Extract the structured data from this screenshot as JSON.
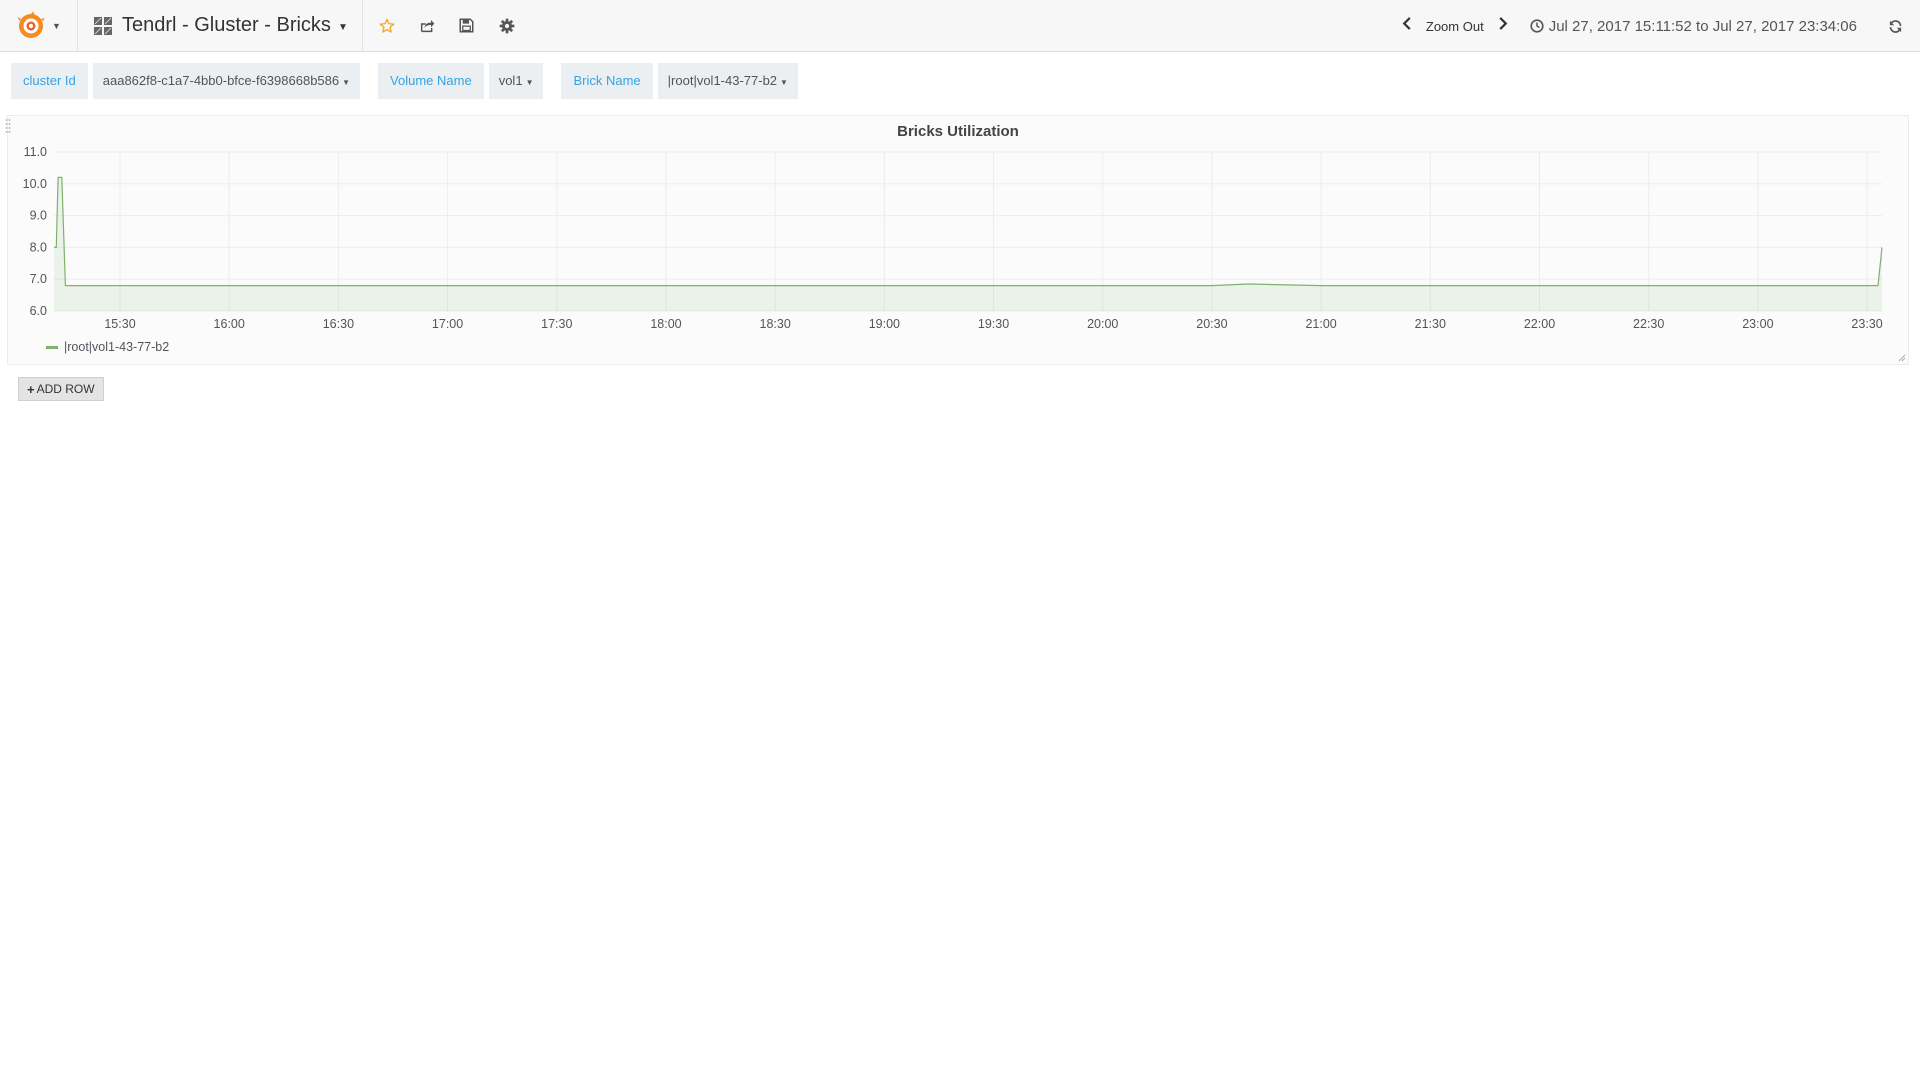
{
  "navbar": {
    "dashboard_title": "Tendrl - Gluster - Bricks",
    "zoom_out_label": "Zoom Out",
    "time_range": "Jul 27, 2017 15:11:52 to Jul 27, 2017 23:34:06",
    "icons": [
      "grafana-logo-icon",
      "dashboard-grid-icon",
      "star-icon",
      "share-icon",
      "save-icon",
      "gear-icon",
      "chevron-left-icon",
      "chevron-right-icon",
      "clock-icon",
      "refresh-icon"
    ],
    "star_color": "#f5a623"
  },
  "variables": [
    {
      "label": "cluster Id",
      "value": "aaa862f8-c1a7-4bb0-bfce-f6398668b586"
    },
    {
      "label": "Volume Name",
      "value": "vol1"
    },
    {
      "label": "Brick Name",
      "value": "|root|vol1-43-77-b2"
    }
  ],
  "panel": {
    "title": "Bricks Utilization",
    "legend_series": "|root|vol1-43-77-b2"
  },
  "add_row_label": "ADD ROW",
  "chart_data": {
    "type": "area",
    "title": "Bricks Utilization",
    "xlabel": "",
    "ylabel": "",
    "x_ticks": [
      "15:30",
      "16:00",
      "16:30",
      "17:00",
      "17:30",
      "18:00",
      "18:30",
      "19:00",
      "19:30",
      "20:00",
      "20:30",
      "21:00",
      "21:30",
      "22:00",
      "22:30",
      "23:00",
      "23:30"
    ],
    "y_ticks": [
      "6.0",
      "7.0",
      "8.0",
      "9.0",
      "10.0",
      "11.0"
    ],
    "xlim": [
      "15:11:52",
      "23:34:06"
    ],
    "ylim": [
      6.0,
      11.0
    ],
    "grid": true,
    "legend_position": "bottom-left",
    "color": "#7eb26d",
    "series": [
      {
        "name": "|root|vol1-43-77-b2",
        "x": [
          "15:11:52",
          "15:12:30",
          "15:13:00",
          "15:14:00",
          "15:15:00",
          "15:30",
          "16:00",
          "16:30",
          "17:00",
          "17:30",
          "18:00",
          "18:30",
          "19:00",
          "19:30",
          "20:00",
          "20:30",
          "20:40",
          "21:00",
          "21:30",
          "22:00",
          "22:30",
          "23:00",
          "23:30",
          "23:33:00",
          "23:34:06"
        ],
        "values": [
          8.0,
          8.0,
          10.2,
          10.2,
          6.8,
          6.8,
          6.8,
          6.8,
          6.8,
          6.8,
          6.8,
          6.8,
          6.8,
          6.8,
          6.8,
          6.8,
          6.85,
          6.8,
          6.8,
          6.8,
          6.8,
          6.8,
          6.8,
          6.8,
          8.0
        ]
      }
    ]
  }
}
